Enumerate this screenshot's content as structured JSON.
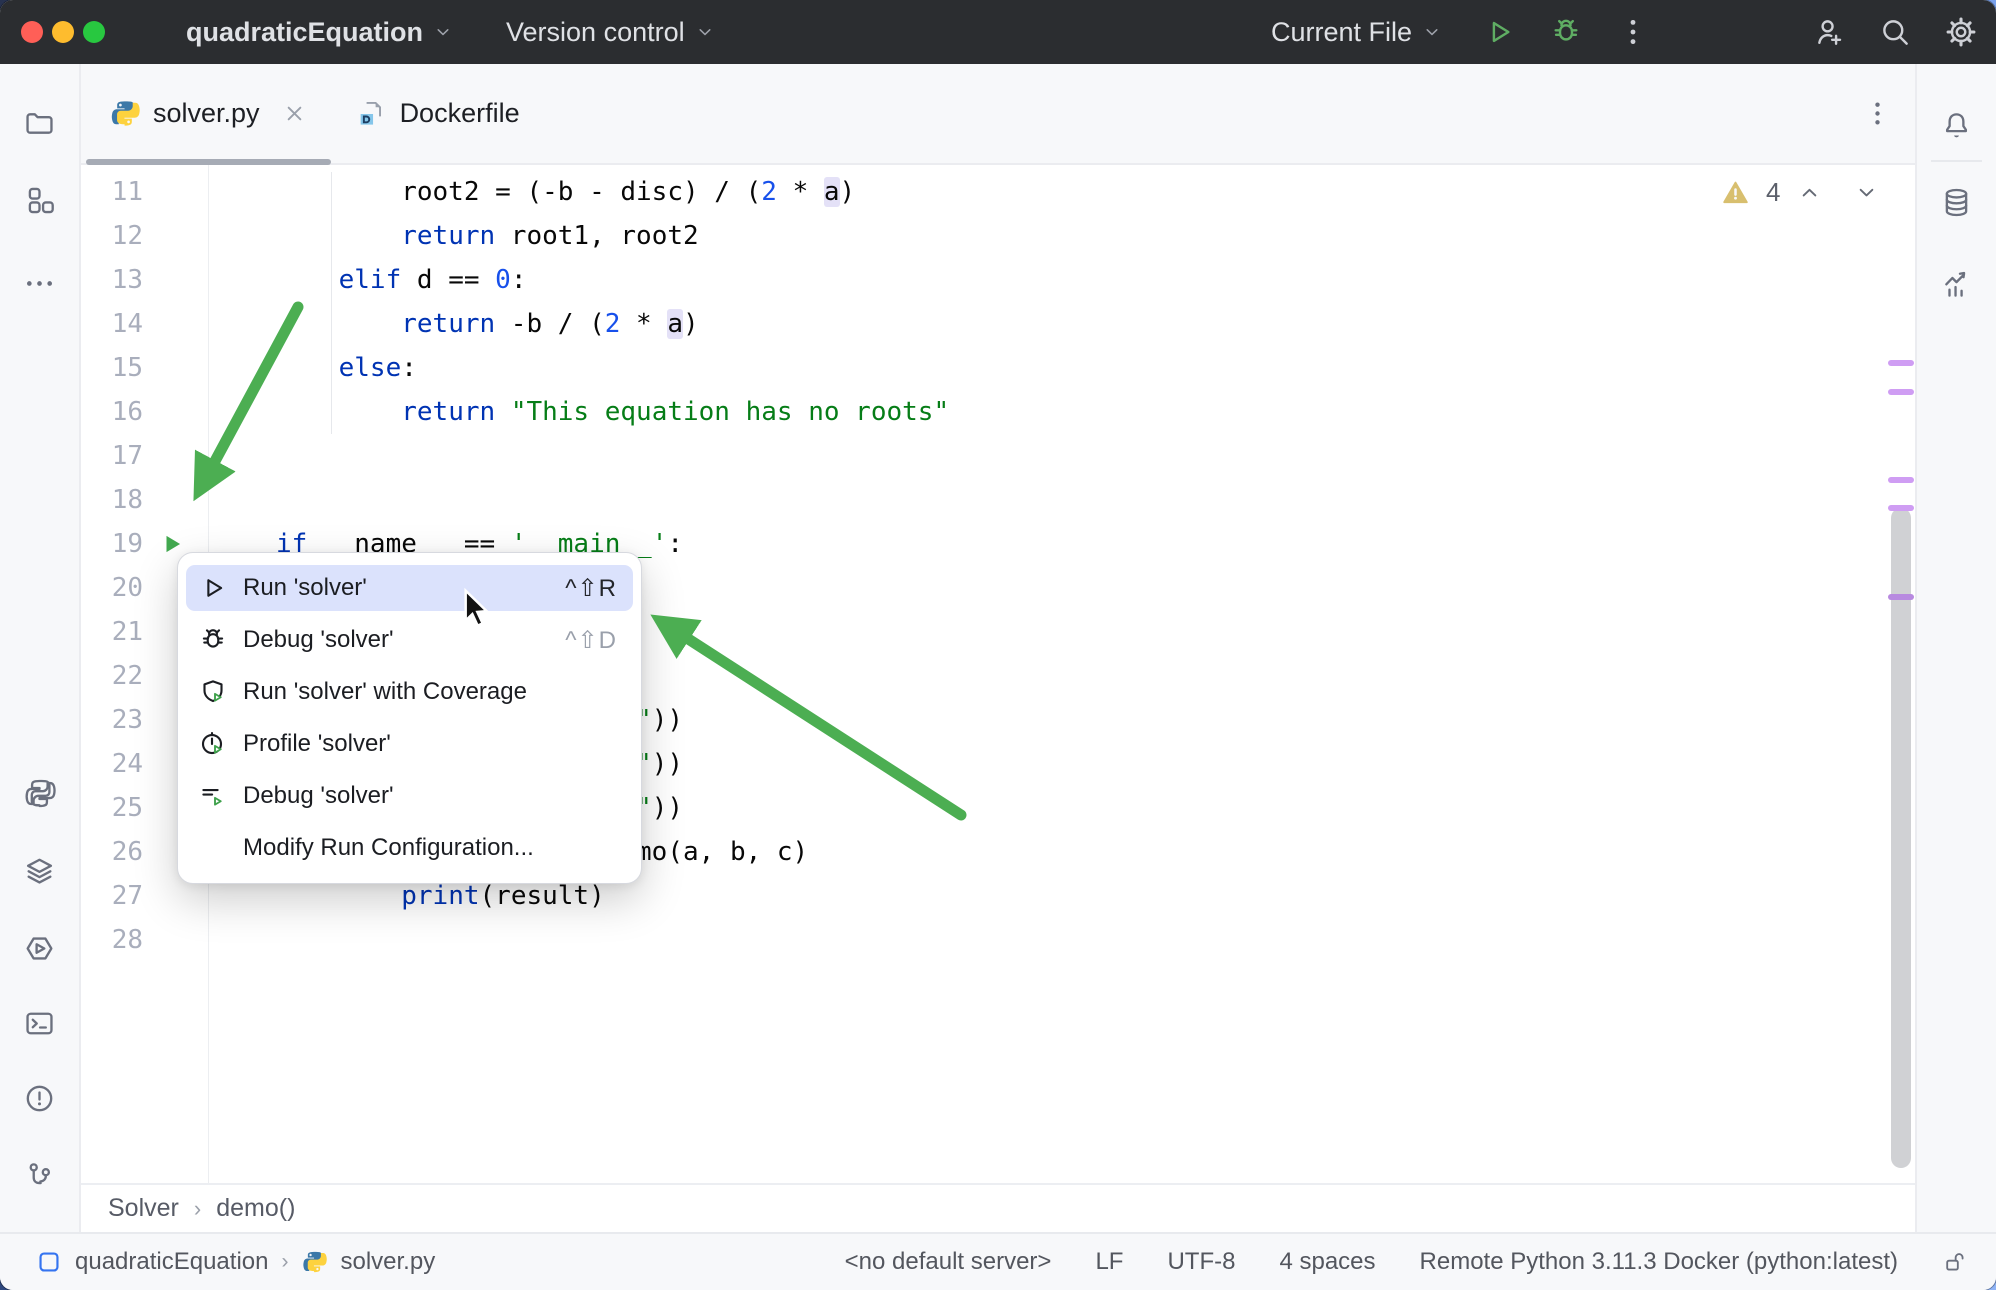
{
  "colors": {
    "annotation_green": "#4cae52",
    "titlebar_bg": "#2b2d30",
    "menu_highlight": "#dbe2fc",
    "keyword": "#0033b3",
    "string": "#067d17",
    "number": "#1750eb",
    "warning_yellow": "#d8bf6f",
    "vcs_change_purple": "#cf9df3",
    "traffic_lights": [
      "#ff5f57",
      "#febc2e",
      "#28c840"
    ]
  },
  "title_bar": {
    "project": "quadraticEquation",
    "version_control": "Version control",
    "run_config": "Current File",
    "actions": [
      {
        "icon": "play-icon",
        "green": true
      },
      {
        "icon": "debug-icon",
        "green": true
      },
      {
        "icon": "kebab-icon",
        "green": false
      }
    ],
    "tools": [
      {
        "icon": "add-user-icon"
      },
      {
        "icon": "search-icon"
      },
      {
        "icon": "settings-icon"
      }
    ]
  },
  "tab_bar": {
    "tabs": [
      {
        "label": "solver.py",
        "icon": "python-color-icon",
        "active": true,
        "closable": true
      },
      {
        "label": "Dockerfile",
        "icon": "dockerfile-icon",
        "active": false,
        "closable": false
      }
    ]
  },
  "editor": {
    "warnings": {
      "count": "4"
    },
    "lines": [
      {
        "n": "11",
        "tokens": [
          [
            "p",
            "        root2 = (-b - disc) / ("
          ],
          [
            "n",
            "2"
          ],
          [
            "p",
            " * "
          ],
          [
            "h",
            "a"
          ],
          [
            "p",
            ")"
          ]
        ]
      },
      {
        "n": "12",
        "tokens": [
          [
            "p",
            "        "
          ],
          [
            "k",
            "return"
          ],
          [
            "p",
            " root1, root2"
          ]
        ]
      },
      {
        "n": "13",
        "tokens": [
          [
            "p",
            "    "
          ],
          [
            "k",
            "elif"
          ],
          [
            "p",
            " d == "
          ],
          [
            "n",
            "0"
          ],
          [
            "p",
            ":"
          ]
        ]
      },
      {
        "n": "14",
        "tokens": [
          [
            "p",
            "        "
          ],
          [
            "k",
            "return"
          ],
          [
            "p",
            " -b / ("
          ],
          [
            "n",
            "2"
          ],
          [
            "p",
            " * "
          ],
          [
            "h",
            "a"
          ],
          [
            "p",
            ")"
          ]
        ]
      },
      {
        "n": "15",
        "tokens": [
          [
            "p",
            "    "
          ],
          [
            "k",
            "else"
          ],
          [
            "p",
            ":"
          ]
        ]
      },
      {
        "n": "16",
        "tokens": [
          [
            "p",
            "        "
          ],
          [
            "k",
            "return"
          ],
          [
            "p",
            " "
          ],
          [
            "s",
            "\"This equation has no roots\""
          ]
        ]
      },
      {
        "n": "17",
        "tokens": []
      },
      {
        "n": "18",
        "tokens": []
      },
      {
        "n": "19",
        "run_marker": true,
        "tokens": [
          [
            "k",
            "if"
          ],
          [
            "p",
            " __name__ == "
          ],
          [
            "s",
            "'__main__'"
          ],
          [
            "p",
            ":"
          ]
        ]
      },
      {
        "n": "20",
        "tokens": []
      },
      {
        "n": "21",
        "tokens": []
      },
      {
        "n": "22",
        "tokens": []
      },
      {
        "n": "23",
        "tokens": [
          [
            "p",
            "                       "
          ],
          [
            "s",
            "\""
          ],
          [
            "p",
            "))"
          ]
        ]
      },
      {
        "n": "24",
        "tokens": [
          [
            "p",
            "                       "
          ],
          [
            "s",
            "\""
          ],
          [
            "p",
            "))"
          ]
        ]
      },
      {
        "n": "25",
        "tokens": [
          [
            "p",
            "                       "
          ],
          [
            "s",
            "\""
          ],
          [
            "p",
            "))"
          ]
        ]
      },
      {
        "n": "26",
        "tokens": [
          [
            "p",
            "                      emo(a, b, c)"
          ]
        ]
      },
      {
        "n": "27",
        "tokens": [
          [
            "p",
            "        "
          ],
          [
            "k",
            "print"
          ],
          [
            "p",
            "(result)"
          ]
        ]
      },
      {
        "n": "28",
        "tokens": []
      }
    ]
  },
  "run_menu": {
    "items": [
      {
        "icon": "run-icon",
        "label": "Run 'solver'",
        "shortcut": "^⇧R",
        "highlighted": true
      },
      {
        "icon": "debug-menu-icon",
        "label": "Debug 'solver'",
        "shortcut": "^⇧D",
        "highlighted": false
      },
      {
        "icon": "coverage-icon",
        "label": "Run 'solver' with Coverage",
        "shortcut": "",
        "highlighted": false
      },
      {
        "icon": "profile-icon",
        "label": "Profile 'solver'",
        "shortcut": "",
        "highlighted": false
      },
      {
        "icon": "concurrency-icon",
        "label": "Debug 'solver'",
        "shortcut": "",
        "highlighted": false
      },
      {
        "icon": "",
        "label": "Modify Run Configuration...",
        "shortcut": "",
        "highlighted": false
      }
    ]
  },
  "left_toolbar": {
    "top": [
      "folder-icon",
      "structure-icon",
      "more-icon"
    ],
    "bottom": [
      "python-icon",
      "layers-icon",
      "services-icon",
      "terminal-icon",
      "problems-icon",
      "branch-icon"
    ]
  },
  "right_toolbar": {
    "top": [
      "bell-icon"
    ],
    "bottom_group": [
      "database-icon",
      "chart-icon"
    ]
  },
  "breadcrumbs": {
    "items": [
      "Solver",
      "demo()"
    ]
  },
  "status_bar": {
    "project": "quadraticEquation",
    "file": "solver.py",
    "server": "<no default server>",
    "line_sep": "LF",
    "encoding": "UTF-8",
    "indent": "4 spaces",
    "interpreter": "Remote Python 3.11.3 Docker (python:latest)"
  }
}
